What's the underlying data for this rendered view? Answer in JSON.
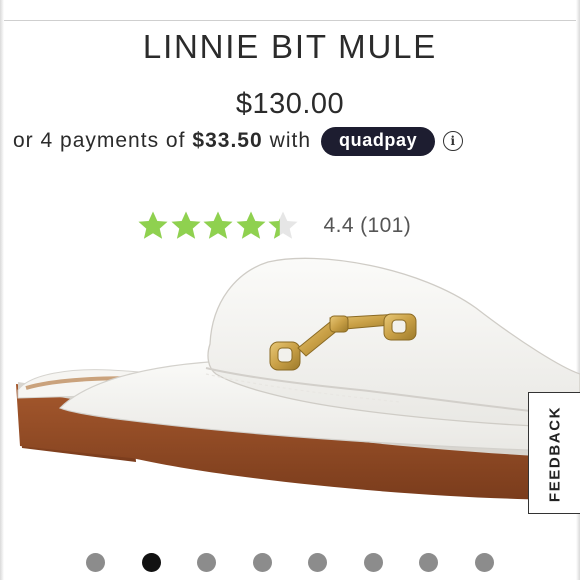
{
  "product": {
    "title": "LINNIE BIT MULE",
    "price": "$130.00"
  },
  "installments": {
    "prefix": "or 4 payments of",
    "amount": "$33.50",
    "suffix": "with",
    "provider": "quadpay",
    "info_icon": "info-circle-icon"
  },
  "rating": {
    "value": 4.4,
    "max": 5,
    "text": "4.4 (101)",
    "star_color": "#8fd14f",
    "empty_color": "#e6e6e6",
    "star_icon": "star-icon"
  },
  "feedback": {
    "label": "FEEDBACK"
  },
  "carousel": {
    "count": 8,
    "active_index": 1,
    "active_color": "#111111",
    "inactive_color": "#8c8c8c"
  }
}
